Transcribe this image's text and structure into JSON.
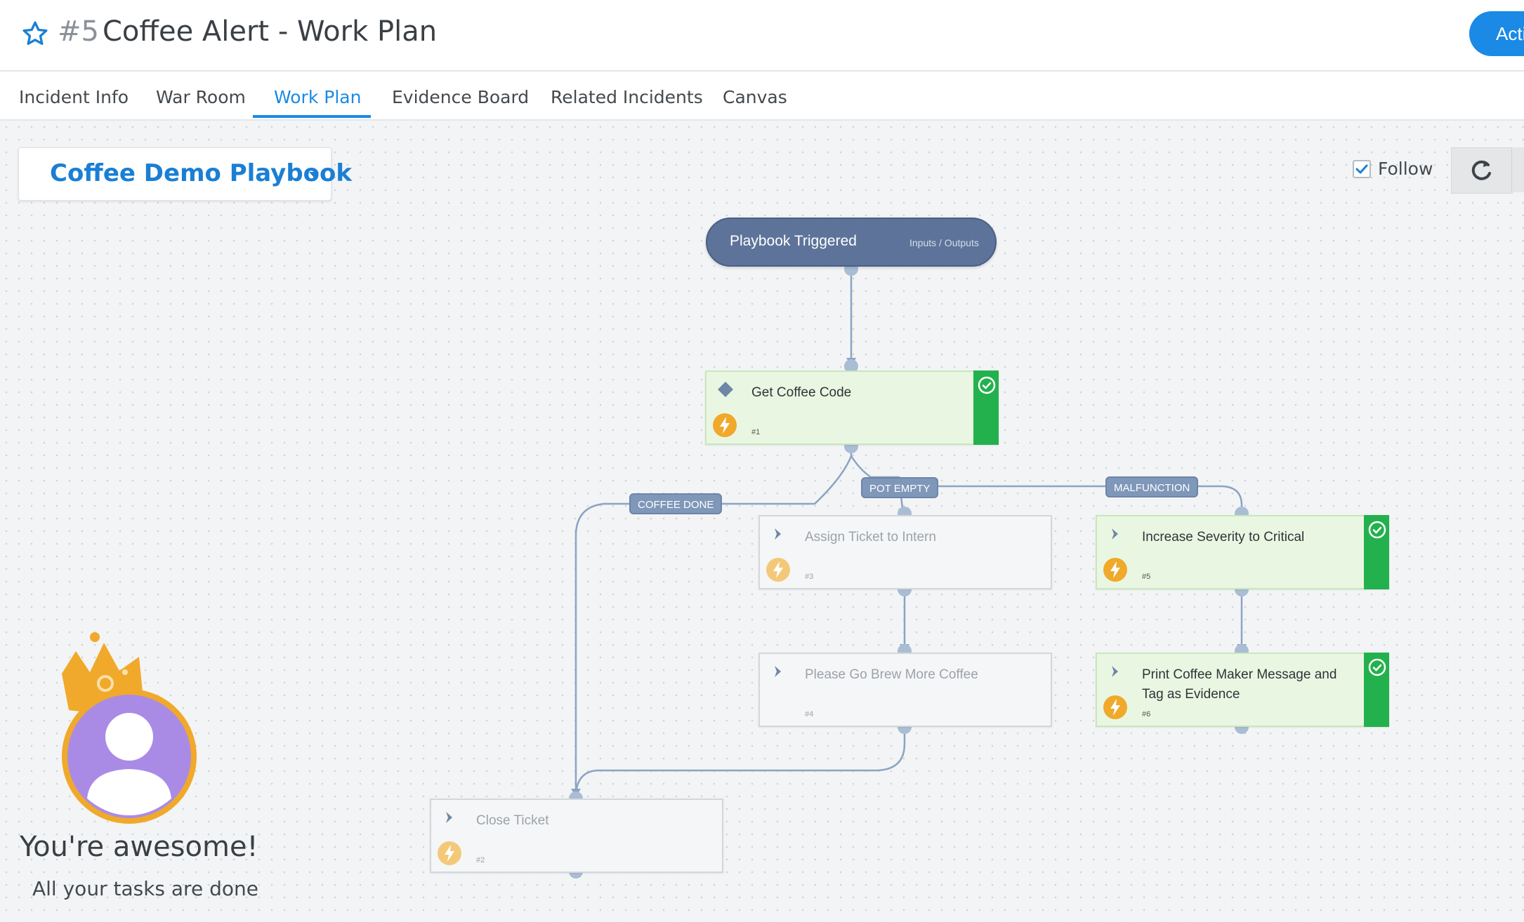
{
  "incident": {
    "number": "#5",
    "title": "Coffee Alert - Work Plan",
    "action_label": "Acti"
  },
  "tabs": [
    {
      "label": "Incident Info"
    },
    {
      "label": "War Room"
    },
    {
      "label": "Work Plan",
      "active": true
    },
    {
      "label": "Evidence Board"
    },
    {
      "label": "Related Incidents"
    },
    {
      "label": "Canvas"
    }
  ],
  "playbook": {
    "name": "Coffee Demo Playbook"
  },
  "follow": {
    "label": "Follow",
    "checked": true
  },
  "start_node": {
    "label": "Playbook Triggered",
    "io_label": "Inputs / Outputs"
  },
  "tasks": {
    "get_coffee_code": {
      "name": "Get Coffee Code",
      "number": "#1",
      "status": "done",
      "type": "condition"
    },
    "assign_intern": {
      "name": "Assign Ticket to Intern",
      "number": "#3",
      "status": "skipped",
      "type": "action"
    },
    "brew_coffee": {
      "name": "Please Go Brew More Coffee",
      "number": "#4",
      "status": "skipped",
      "type": "action"
    },
    "close_ticket": {
      "name": "Close Ticket",
      "number": "#2",
      "status": "skipped",
      "type": "action"
    },
    "increase_severity": {
      "name": "Increase Severity to Critical",
      "number": "#5",
      "status": "done",
      "type": "action"
    },
    "print_message": {
      "name": "Print Coffee Maker Message and Tag as Evidence",
      "number": "#6",
      "status": "done",
      "type": "action"
    }
  },
  "edge_labels": {
    "coffee_done": "COFFEE DONE",
    "pot_empty": "POT EMPTY",
    "malfunction": "MALFUNCTION"
  },
  "celebration": {
    "title": "You're awesome!",
    "subtitle": "All your tasks are done"
  },
  "colors": {
    "accent": "#1a8ae6",
    "done": "#23b14d",
    "node": "#5d7399",
    "edge": "#7f97b8",
    "bolt": "#f0a92a"
  }
}
